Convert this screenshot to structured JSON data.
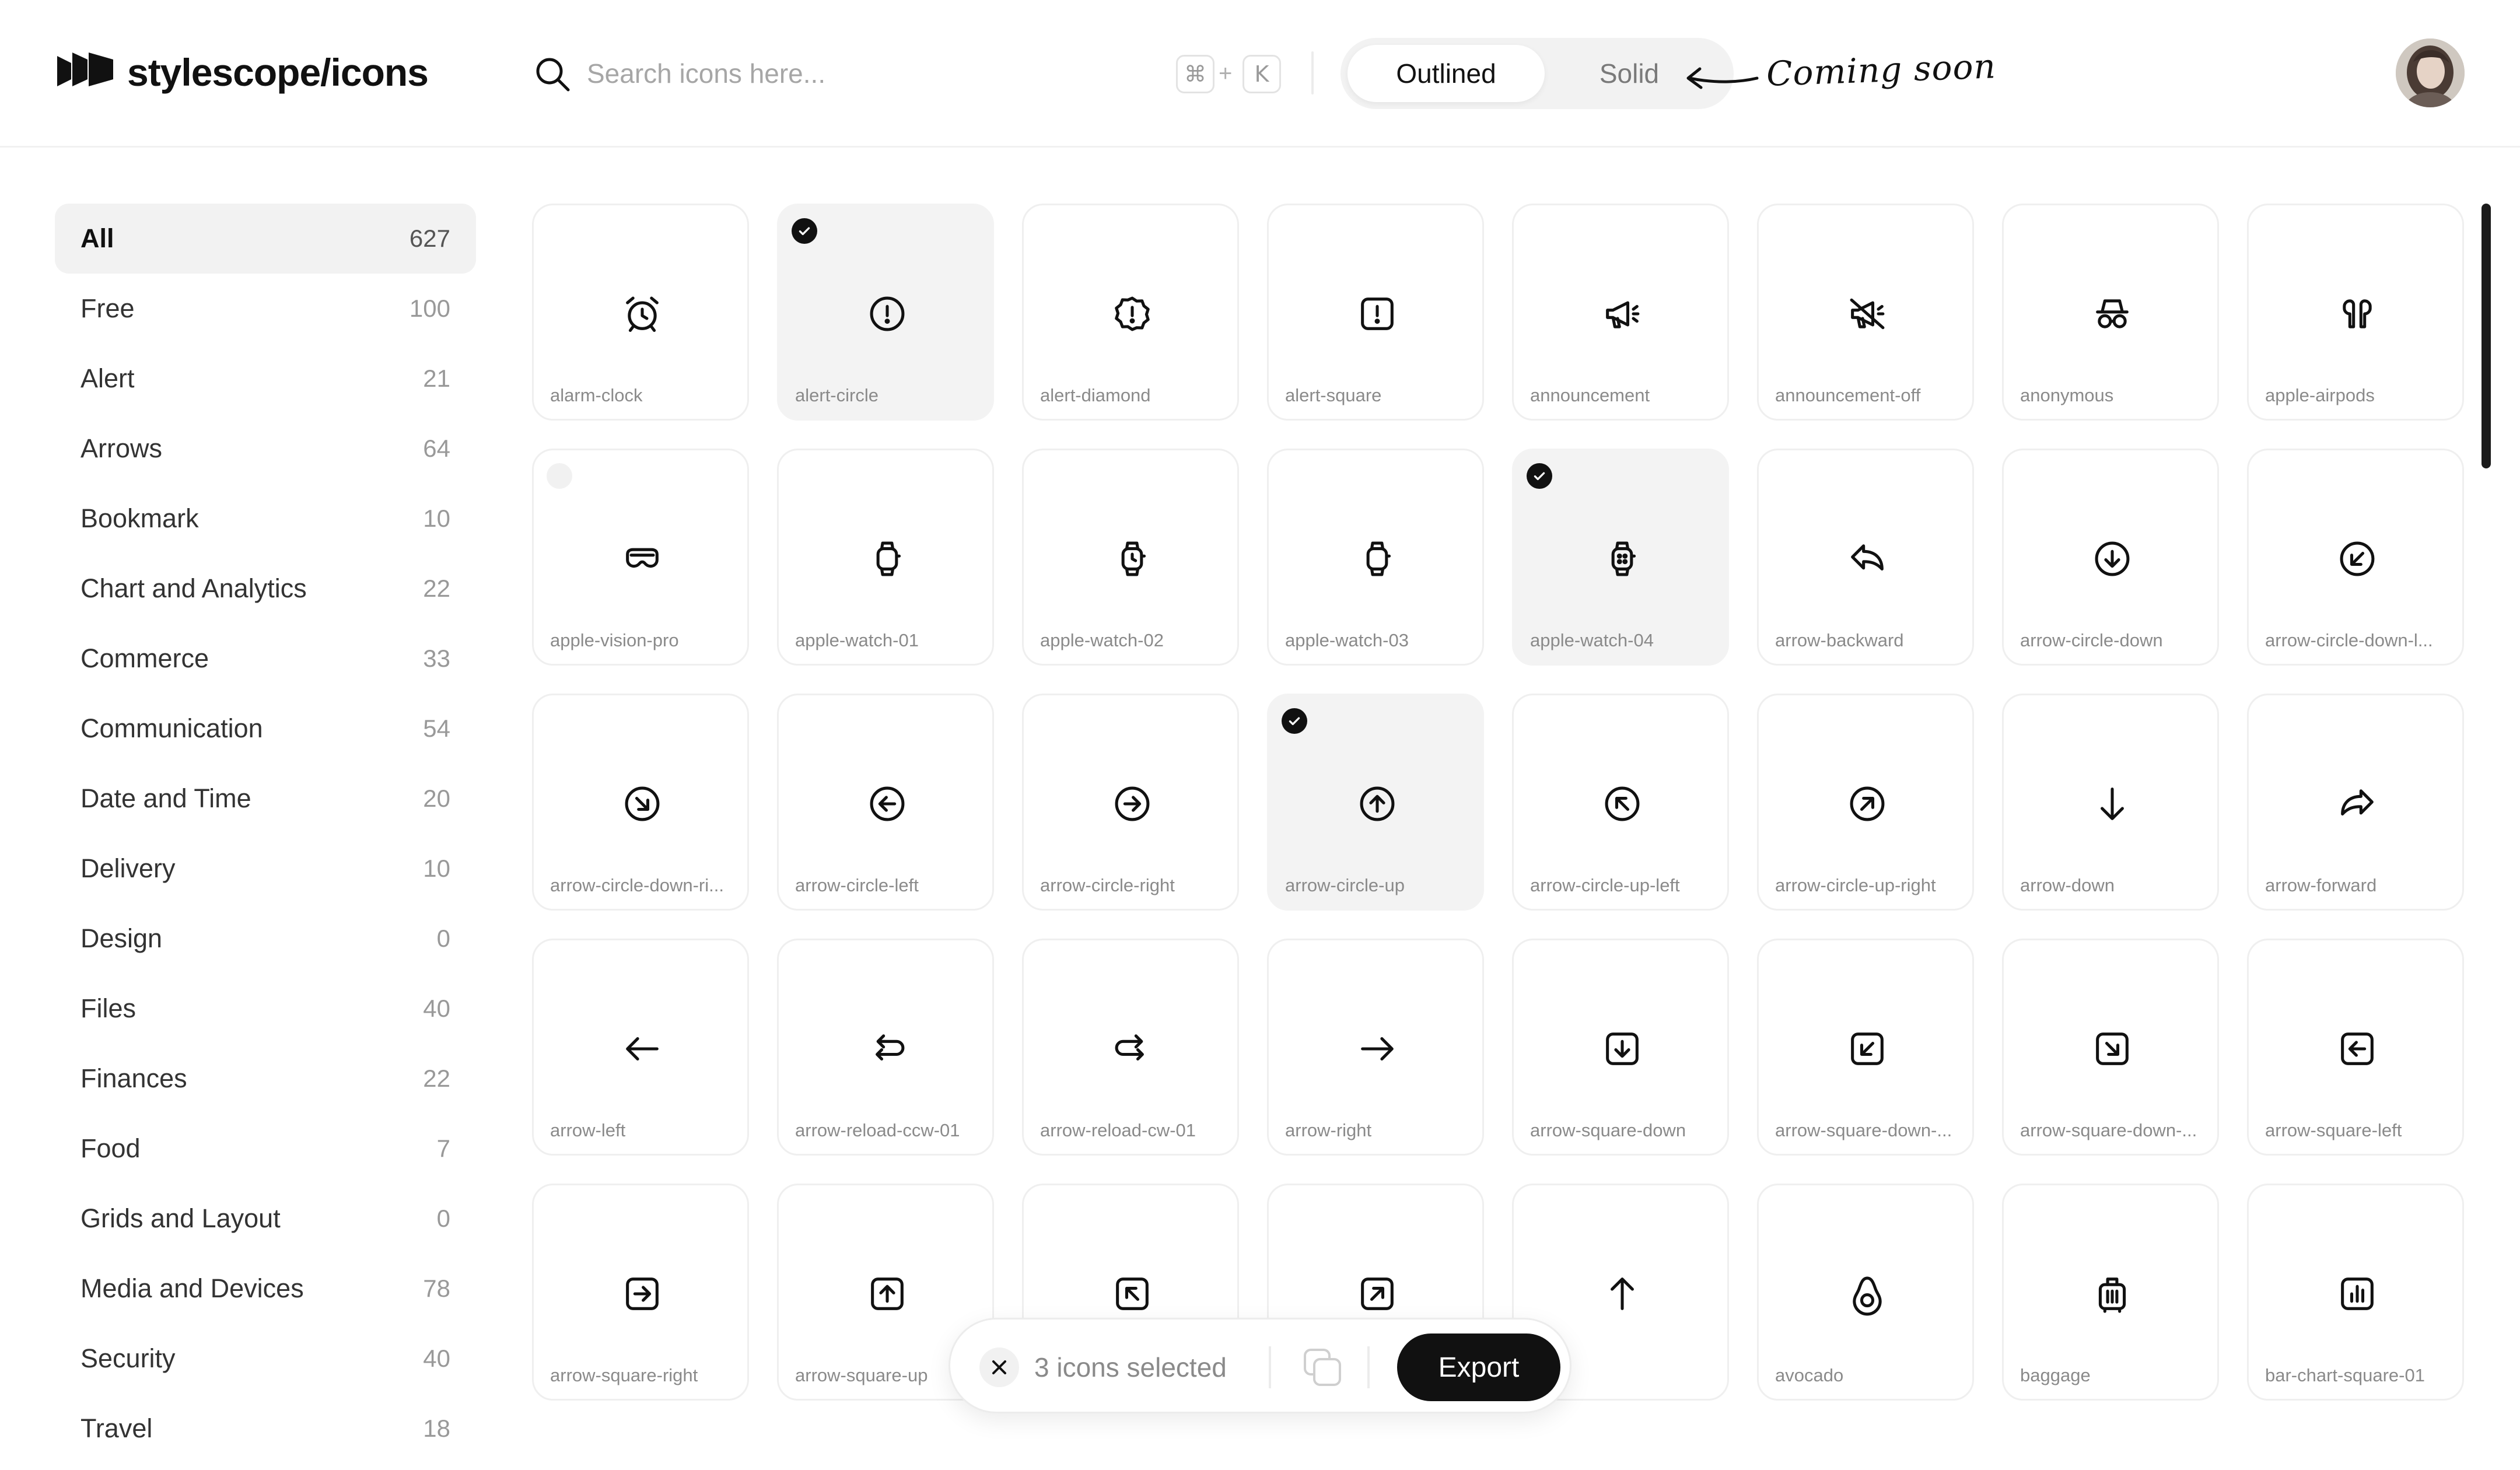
{
  "brand": {
    "name": "stylescope/icons"
  },
  "search": {
    "placeholder": "Search icons here...",
    "shortcut_key1": "⌘",
    "shortcut_plus": "+",
    "shortcut_key2": "K"
  },
  "style_toggle": {
    "active": "Outlined",
    "inactive": "Solid",
    "note": "Coming soon"
  },
  "sidebar": {
    "items": [
      {
        "label": "All",
        "count": "627",
        "active": true
      },
      {
        "label": "Free",
        "count": "100"
      },
      {
        "label": "Alert",
        "count": "21"
      },
      {
        "label": "Arrows",
        "count": "64"
      },
      {
        "label": "Bookmark",
        "count": "10"
      },
      {
        "label": "Chart and Analytics",
        "count": "22"
      },
      {
        "label": "Commerce",
        "count": "33"
      },
      {
        "label": "Communication",
        "count": "54"
      },
      {
        "label": "Date and Time",
        "count": "20"
      },
      {
        "label": "Delivery",
        "count": "10"
      },
      {
        "label": "Design",
        "count": "0"
      },
      {
        "label": "Files",
        "count": "40"
      },
      {
        "label": "Finances",
        "count": "22"
      },
      {
        "label": "Food",
        "count": "7"
      },
      {
        "label": "Grids and Layout",
        "count": "0"
      },
      {
        "label": "Media and Devices",
        "count": "78"
      },
      {
        "label": "Security",
        "count": "40"
      },
      {
        "label": "Travel",
        "count": "18"
      }
    ]
  },
  "icons": [
    {
      "name": "alarm-clock",
      "glyph": "alarm-clock"
    },
    {
      "name": "alert-circle",
      "glyph": "alert-circle",
      "selected": true
    },
    {
      "name": "alert-diamond",
      "glyph": "alert-diamond"
    },
    {
      "name": "alert-square",
      "glyph": "alert-square"
    },
    {
      "name": "announcement",
      "glyph": "announcement"
    },
    {
      "name": "announcement-off",
      "glyph": "announcement-off"
    },
    {
      "name": "anonymous",
      "glyph": "anonymous"
    },
    {
      "name": "apple-airpods",
      "glyph": "apple-airpods"
    },
    {
      "name": "apple-vision-pro",
      "glyph": "apple-vision-pro",
      "hover": true
    },
    {
      "name": "apple-watch-01",
      "glyph": "watch"
    },
    {
      "name": "apple-watch-02",
      "glyph": "watch-clock"
    },
    {
      "name": "apple-watch-03",
      "glyph": "watch"
    },
    {
      "name": "apple-watch-04",
      "glyph": "watch-dots",
      "selected": true
    },
    {
      "name": "arrow-backward",
      "glyph": "arrow-backward"
    },
    {
      "name": "arrow-circle-down",
      "glyph": "circle-down"
    },
    {
      "name": "arrow-circle-down-l...",
      "glyph": "circle-down-left"
    },
    {
      "name": "arrow-circle-down-ri...",
      "glyph": "circle-down-right"
    },
    {
      "name": "arrow-circle-left",
      "glyph": "circle-left"
    },
    {
      "name": "arrow-circle-right",
      "glyph": "circle-right"
    },
    {
      "name": "arrow-circle-up",
      "glyph": "circle-up",
      "selected": true
    },
    {
      "name": "arrow-circle-up-left",
      "glyph": "circle-up-left"
    },
    {
      "name": "arrow-circle-up-right",
      "glyph": "circle-up-right"
    },
    {
      "name": "arrow-down",
      "glyph": "arrow-down"
    },
    {
      "name": "arrow-forward",
      "glyph": "arrow-forward"
    },
    {
      "name": "arrow-left",
      "glyph": "arrow-left"
    },
    {
      "name": "arrow-reload-ccw-01",
      "glyph": "reload-ccw"
    },
    {
      "name": "arrow-reload-cw-01",
      "glyph": "reload-cw"
    },
    {
      "name": "arrow-right",
      "glyph": "arrow-right"
    },
    {
      "name": "arrow-square-down",
      "glyph": "square-down"
    },
    {
      "name": "arrow-square-down-...",
      "glyph": "square-down-left"
    },
    {
      "name": "arrow-square-down-...",
      "glyph": "square-down-right"
    },
    {
      "name": "arrow-square-left",
      "glyph": "square-left"
    },
    {
      "name": "arrow-square-right",
      "glyph": "square-right"
    },
    {
      "name": "arrow-square-up",
      "glyph": "square-up"
    },
    {
      "name": "",
      "glyph": "square-up-left"
    },
    {
      "name": "",
      "glyph": "square-up-right"
    },
    {
      "name": "w-up",
      "glyph": "arrow-up"
    },
    {
      "name": "avocado",
      "glyph": "avocado"
    },
    {
      "name": "baggage",
      "glyph": "baggage"
    },
    {
      "name": "bar-chart-square-01",
      "glyph": "bar-chart-square"
    }
  ],
  "selection": {
    "text": "3 icons selected",
    "export_label": "Export"
  }
}
